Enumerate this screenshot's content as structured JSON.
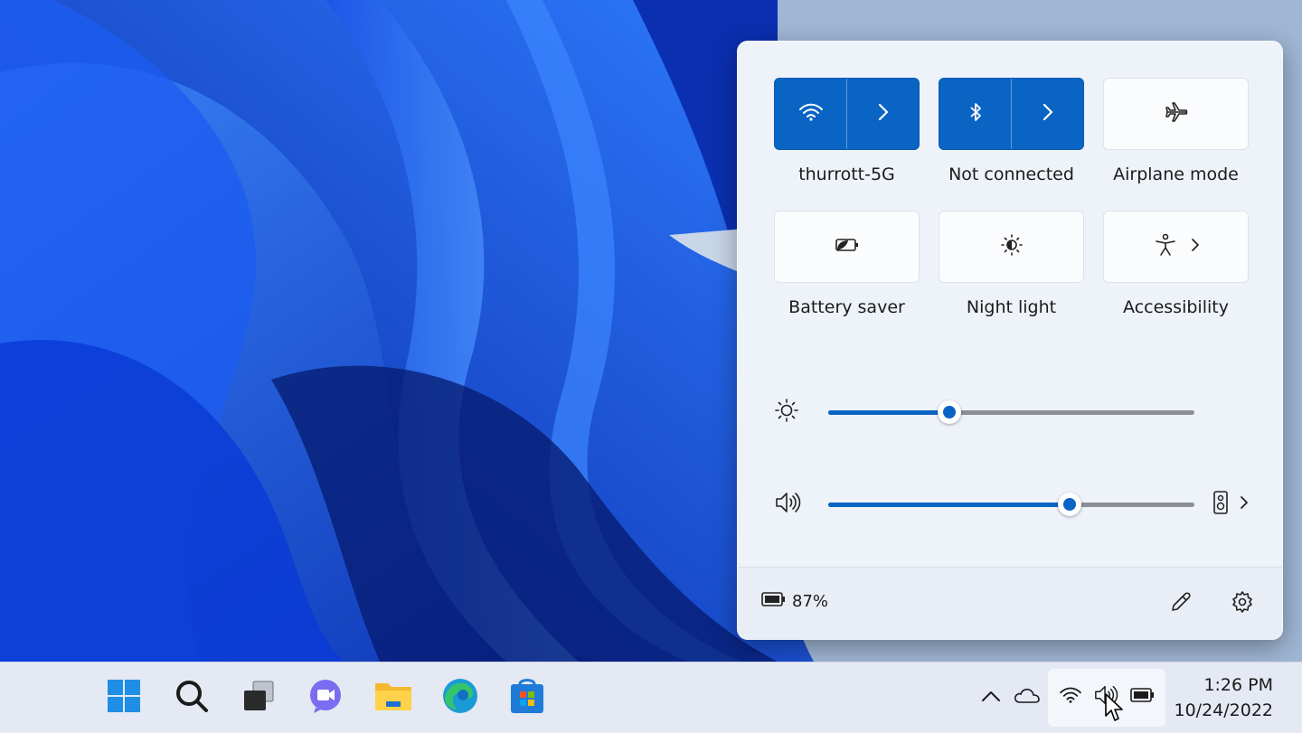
{
  "quick_settings": {
    "tiles": [
      {
        "id": "wifi",
        "label": "thurrott-5G",
        "active": true,
        "icon": "wifi-icon",
        "has_arrow": true
      },
      {
        "id": "bluetooth",
        "label": "Not connected",
        "active": true,
        "icon": "bluetooth-icon",
        "has_arrow": true
      },
      {
        "id": "airplane",
        "label": "Airplane mode",
        "active": false,
        "icon": "airplane-icon",
        "has_arrow": false
      },
      {
        "id": "battery_saver",
        "label": "Battery saver",
        "active": false,
        "icon": "battery-saver-icon",
        "has_arrow": false
      },
      {
        "id": "night_light",
        "label": "Night light",
        "active": false,
        "icon": "night-light-icon",
        "has_arrow": false
      },
      {
        "id": "accessibility",
        "label": "Accessibility",
        "active": false,
        "icon": "accessibility-icon",
        "has_arrow": true
      }
    ],
    "brightness": {
      "value": 0.33,
      "icon": "brightness-icon"
    },
    "volume": {
      "value": 0.66,
      "icon": "volume-icon",
      "output_icon": "speaker-device-icon"
    },
    "footer": {
      "battery_percent": "87%",
      "battery_icon": "battery-icon",
      "edit_icon": "pencil-icon",
      "settings_icon": "gear-icon"
    }
  },
  "taskbar": {
    "apps": [
      {
        "name": "start-button",
        "icon": "windows-logo-icon"
      },
      {
        "name": "search-button",
        "icon": "search-icon"
      },
      {
        "name": "task-view-button",
        "icon": "task-view-icon"
      },
      {
        "name": "teams-chat-button",
        "icon": "teams-chat-icon"
      },
      {
        "name": "file-explorer-button",
        "icon": "folder-icon"
      },
      {
        "name": "edge-button",
        "icon": "edge-icon"
      },
      {
        "name": "store-button",
        "icon": "store-icon"
      }
    ],
    "tray": {
      "overflow_icon": "chevron-up-icon",
      "onedrive_icon": "cloud-icon",
      "wifi_icon": "wifi-icon",
      "volume_icon": "volume-icon",
      "battery_icon": "battery-icon"
    },
    "clock": {
      "time": "1:26 PM",
      "date": "10/24/2022"
    }
  },
  "colors": {
    "accent": "#0a64c4",
    "panel": "#eef2f9",
    "taskbar": "#e4e9f3"
  }
}
